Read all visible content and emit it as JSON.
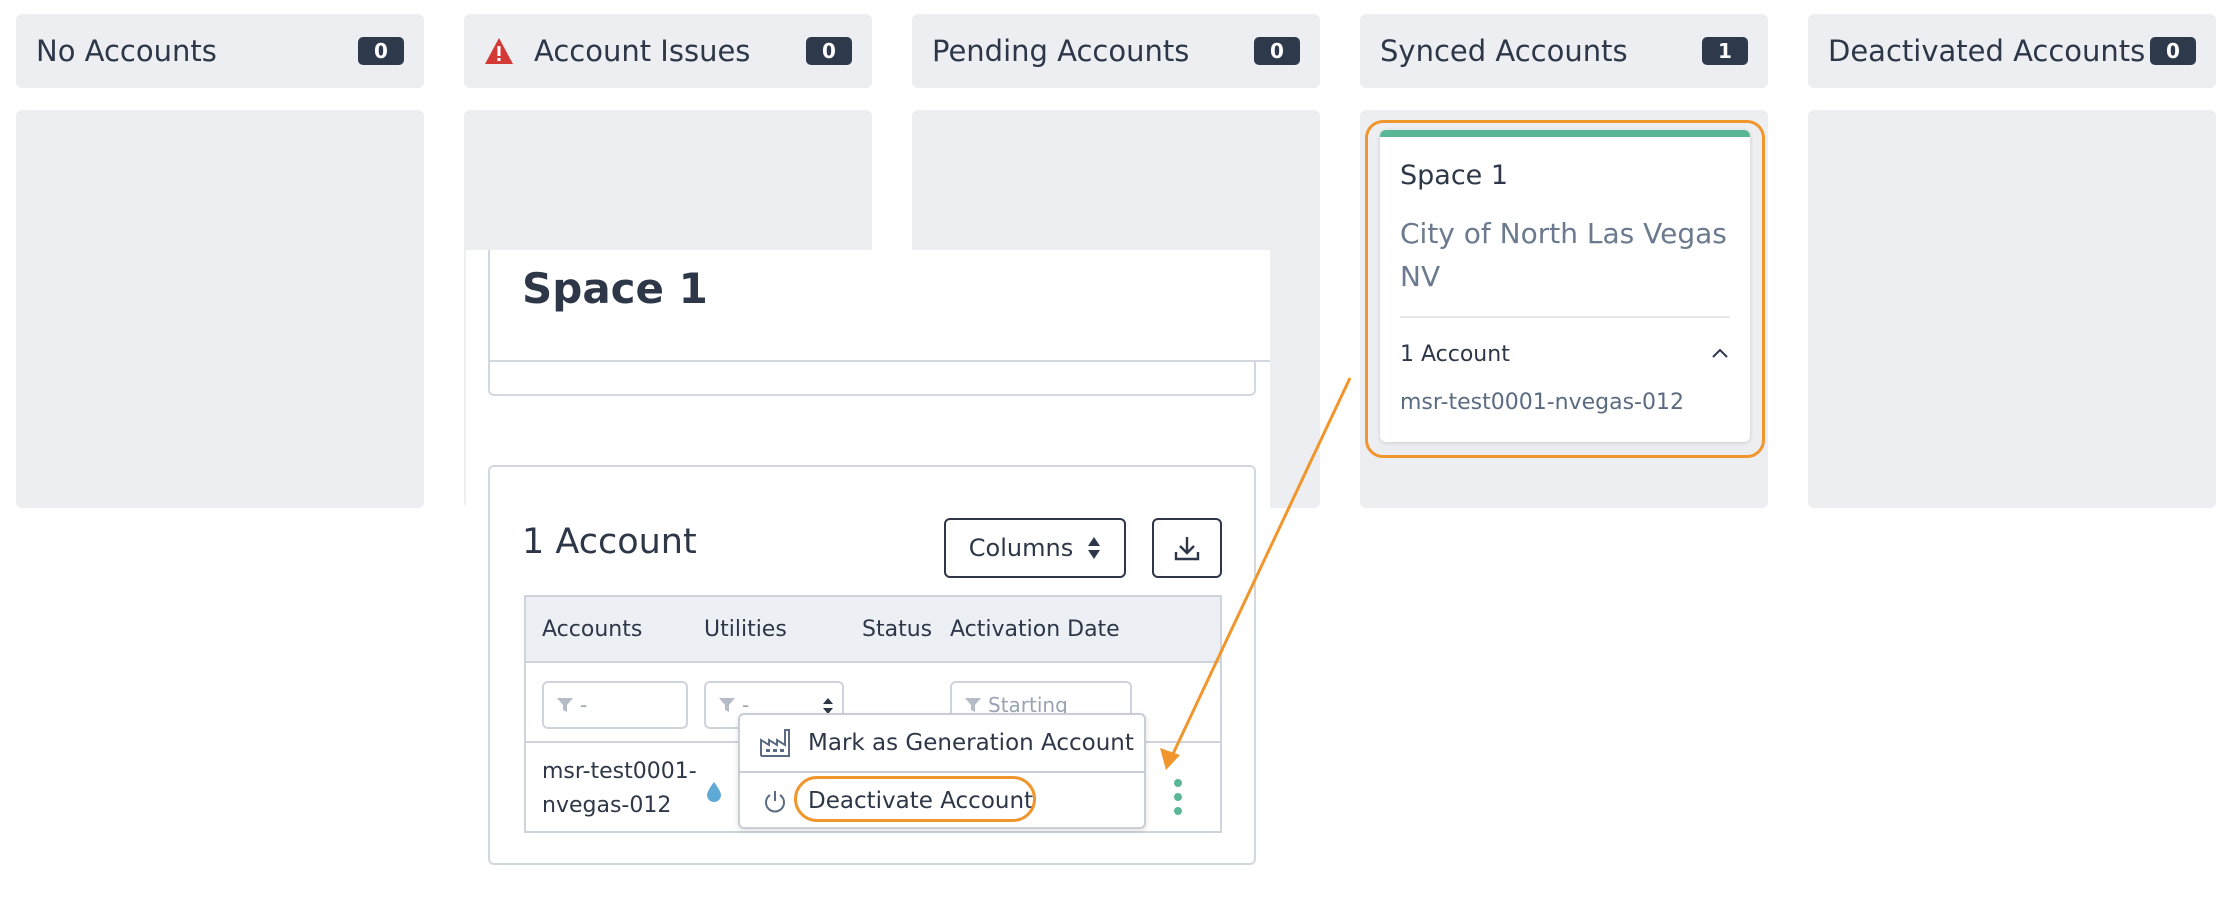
{
  "columns": [
    {
      "title": "No Accounts",
      "count": "0"
    },
    {
      "title": "Account Issues",
      "count": "0"
    },
    {
      "title": "Pending Accounts",
      "count": "0"
    },
    {
      "title": "Synced Accounts",
      "count": "1"
    },
    {
      "title": "Deactivated Accounts",
      "count": "0"
    }
  ],
  "synced_card": {
    "space_name": "Space 1",
    "city": "City of North Las Vegas NV",
    "account_count": "1 Account",
    "account_id": "msr-test0001-nvegas-012"
  },
  "detail": {
    "title": "Space 1",
    "account_count": "1 Account",
    "columns_button": "Columns",
    "table": {
      "headers": [
        "Accounts",
        "Utilities",
        "Status",
        "Activation Date"
      ],
      "filters": {
        "accounts": "-",
        "utilities": "-",
        "activation_date": "Starting"
      },
      "row": {
        "account_line1": "msr-test0001-",
        "account_line2": "nvegas-012"
      }
    }
  },
  "menu": {
    "items": [
      {
        "label": "Mark as Generation Account",
        "icon": "factory-icon"
      },
      {
        "label": "Deactivate Account",
        "icon": "power-icon"
      }
    ]
  },
  "colors": {
    "highlight": "#f0962c",
    "synced": "#5ab796",
    "warning": "#d33a35",
    "badge": "#2e3a4b"
  }
}
